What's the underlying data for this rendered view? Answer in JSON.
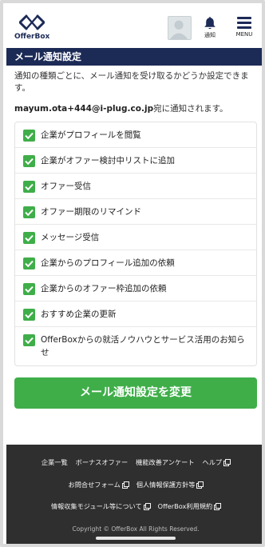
{
  "header": {
    "logo_text": "OfferBox",
    "notification_label": "通知",
    "menu_label": "MENU",
    "brand_color": "#1c2a56"
  },
  "page_title": "メール通知設定",
  "description": "通知の種類ごとに、メール通知を受け取るかどうか設定できます。",
  "email_notice": {
    "email": "mayum.ota+444@i-plug.co.jp",
    "suffix": "宛に通知されます。"
  },
  "options": [
    {
      "label": "企業がプロフィールを閲覧",
      "checked": true
    },
    {
      "label": "企業がオファー検討中リストに追加",
      "checked": true
    },
    {
      "label": "オファー受信",
      "checked": true
    },
    {
      "label": "オファー期限のリマインド",
      "checked": true
    },
    {
      "label": "メッセージ受信",
      "checked": true
    },
    {
      "label": "企業からのプロフィール追加の依頼",
      "checked": true
    },
    {
      "label": "企業からのオファー枠追加の依頼",
      "checked": true
    },
    {
      "label": "おすすめ企業の更新",
      "checked": true
    },
    {
      "label": "OfferBoxからの就活ノウハウとサービス活用のお知らせ",
      "checked": true
    }
  ],
  "submit_label": "メール通知設定を変更",
  "accent_color": "#3fae49",
  "footer": {
    "row1": [
      "企業一覧",
      "ボーナスオファー",
      "機能改善アンケート",
      "ヘルプ"
    ],
    "row2": [
      "お問合せフォーム",
      "個人情報保護方針等"
    ],
    "row3": [
      "情報収集モジュール等について",
      "OfferBox利用規約"
    ],
    "copyright": "Copyright © OfferBox All Rights Reserved."
  }
}
